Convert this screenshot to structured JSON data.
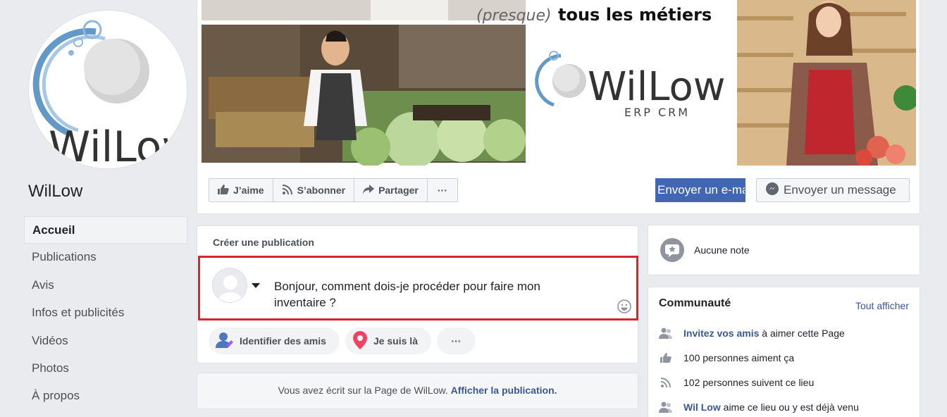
{
  "page": {
    "name": "WilLow",
    "logo_text": "WilLow"
  },
  "cover": {
    "tagline_italic": "(presque)",
    "tagline_bold": "tous les métiers",
    "brand": "WilLow",
    "brand_sub": "ERP CRM"
  },
  "sidebar": {
    "items": [
      {
        "label": "Accueil",
        "active": true
      },
      {
        "label": "Publications"
      },
      {
        "label": "Avis"
      },
      {
        "label": "Infos et publicités"
      },
      {
        "label": "Vidéos"
      },
      {
        "label": "Photos"
      },
      {
        "label": "À propos"
      }
    ]
  },
  "actions": {
    "like": "J’aime",
    "follow": "S’abonner",
    "share": "Partager",
    "more": "···",
    "email": "Envoyer un e-mail",
    "message": "Envoyer un message"
  },
  "create_post": {
    "title": "Créer une publication",
    "text": "Bonjour, comment dois-je procéder pour faire mon inventaire ?",
    "tag_friends": "Identifier des amis",
    "checkin": "Je suis là",
    "more": "···"
  },
  "notice": {
    "text": "Vous avez écrit sur la Page de WilLow.",
    "link": "Afficher la publication."
  },
  "notes": {
    "label": "Aucune note"
  },
  "community": {
    "title": "Communauté",
    "see_all": "Tout afficher",
    "invite_link": "Invitez vos amis",
    "invite_rest": "à aimer cette Page",
    "likes": "100 personnes aiment ça",
    "follows": "102 personnes suivent ce lieu",
    "visitor_link": "Wil Low",
    "visitor_rest": "aime ce lieu ou y est déjà venu"
  },
  "colors": {
    "brand_blue": "#4267b2",
    "link_blue": "#385898",
    "highlight_red": "#d9232d",
    "background": "#e9ebee"
  }
}
